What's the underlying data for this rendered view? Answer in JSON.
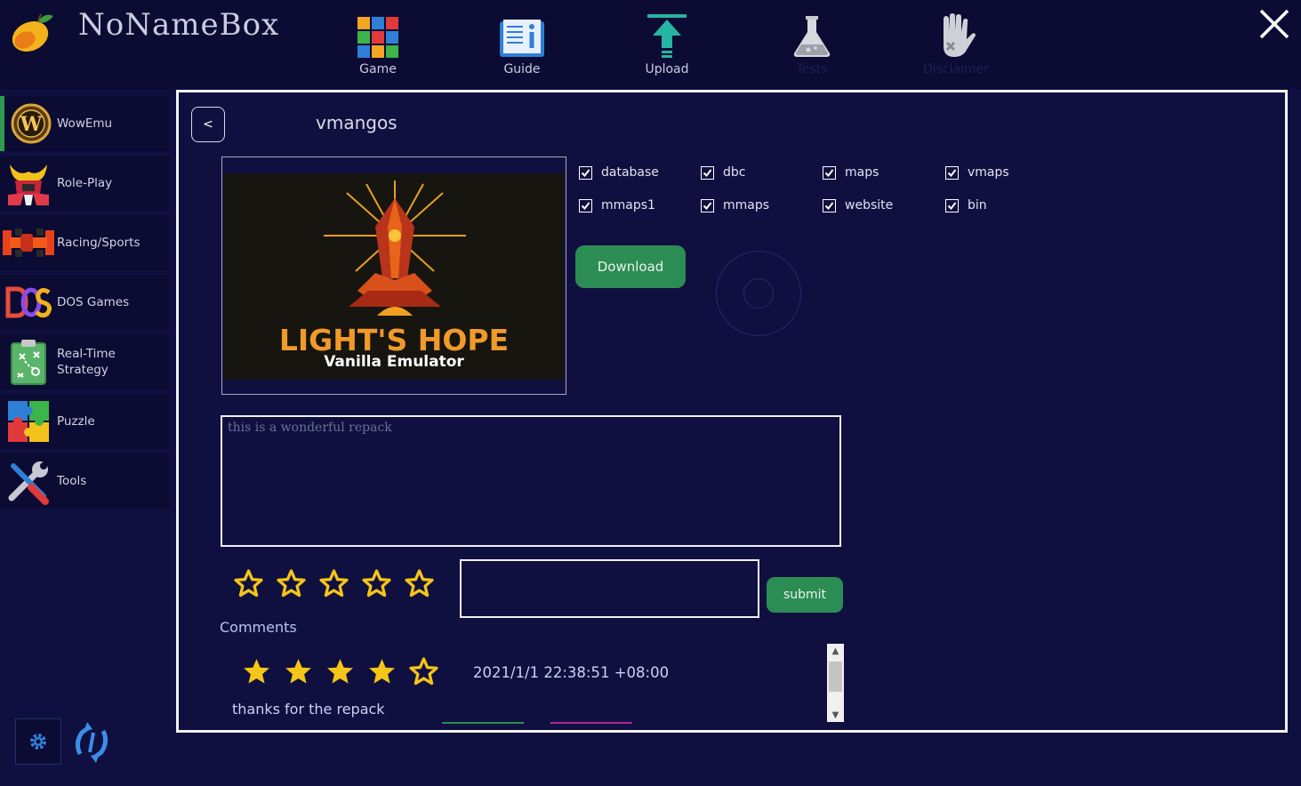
{
  "app": {
    "title": "NoNameBox"
  },
  "topnav": [
    {
      "label": "Game",
      "icon": "game-grid-icon"
    },
    {
      "label": "Guide",
      "icon": "guide-book-icon"
    },
    {
      "label": "Upload",
      "icon": "upload-arrow-icon"
    },
    {
      "label": "Tests",
      "icon": "flask-icon"
    },
    {
      "label": "Disclaimer",
      "icon": "hand-icon"
    }
  ],
  "sidebar": {
    "items": [
      {
        "label": "WowEmu",
        "icon": "wow-logo-icon",
        "active": true
      },
      {
        "label": "Role-Play",
        "icon": "samurai-helmet-icon"
      },
      {
        "label": "Racing/Sports",
        "icon": "race-car-icon"
      },
      {
        "label": "DOS Games",
        "icon": "dos-logo-icon"
      },
      {
        "label": "Real-Time\nStrategy",
        "icon": "strategy-board-icon"
      },
      {
        "label": "Puzzle",
        "icon": "puzzle-piece-icon"
      },
      {
        "label": "Tools",
        "icon": "tools-icon"
      }
    ]
  },
  "detail": {
    "back_label": "<",
    "title": "vmangos",
    "image": {
      "title": "LIGHT'S HOPE",
      "subtitle": "Vanilla Emulator"
    },
    "checkboxes": [
      {
        "label": "database",
        "checked": true
      },
      {
        "label": "dbc",
        "checked": true
      },
      {
        "label": "maps",
        "checked": true
      },
      {
        "label": "vmaps",
        "checked": true
      },
      {
        "label": "mmaps1",
        "checked": true
      },
      {
        "label": "mmaps",
        "checked": true
      },
      {
        "label": "website",
        "checked": true
      },
      {
        "label": "bin",
        "checked": true
      }
    ],
    "download_label": "Download",
    "description": "this is a wonderful repack",
    "rating_input": {
      "value": 0,
      "max": 5
    },
    "comment_input": "",
    "submit_label": "submit",
    "comments_heading": "Comments",
    "comments": [
      {
        "rating": 4,
        "max": 5,
        "time": "2021/1/1 22:38:51 +08:00",
        "text": "thanks for the repack"
      }
    ]
  },
  "colors": {
    "background": "#101040",
    "titlebar": "#0b0b33",
    "accent_green": "#2b8d53",
    "star_gold": "#f5c518"
  }
}
